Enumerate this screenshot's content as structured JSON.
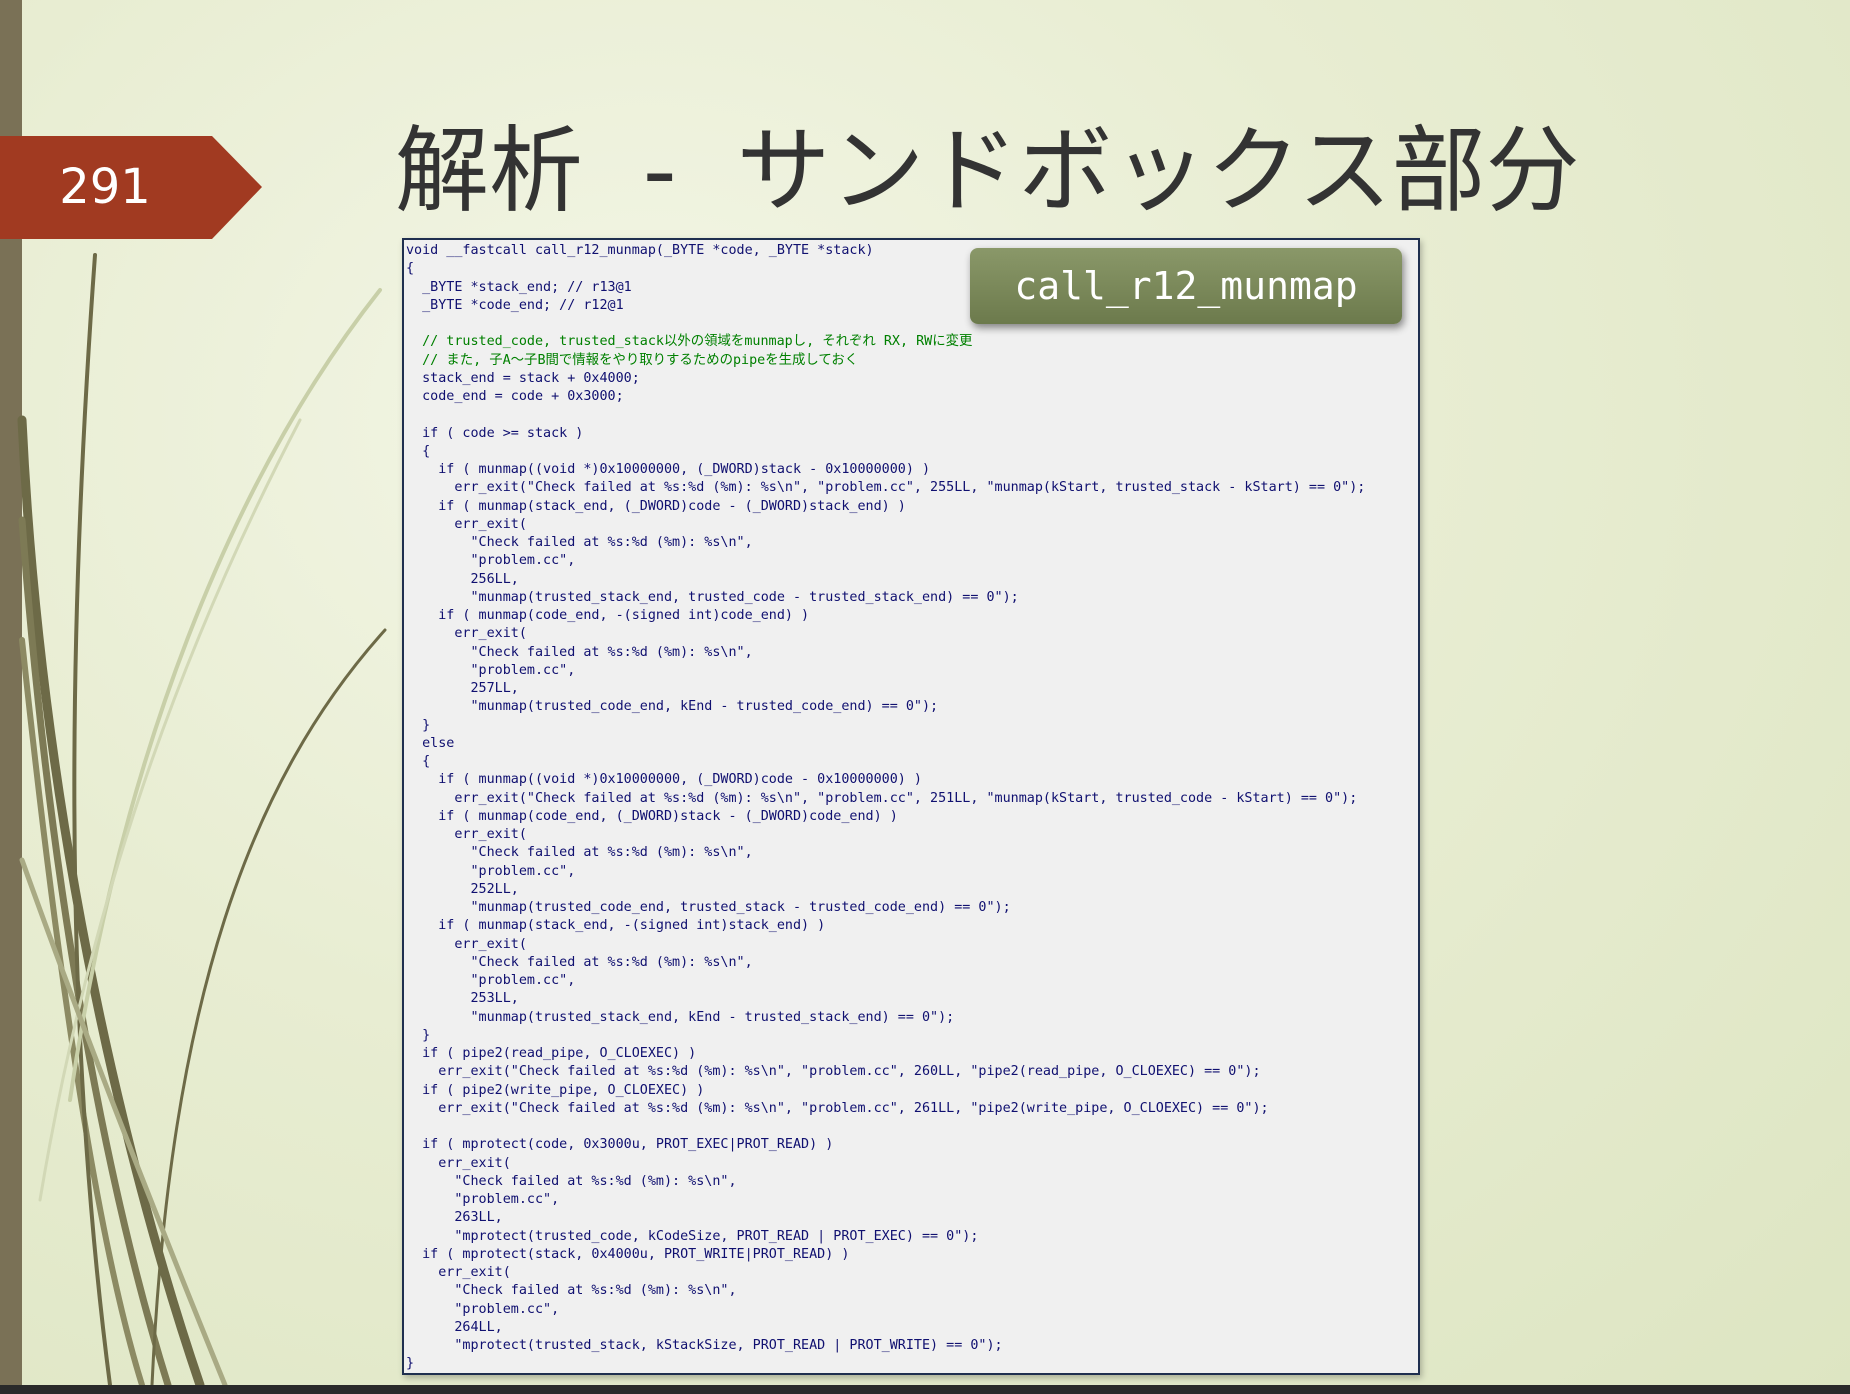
{
  "slide": {
    "number": "291",
    "title": "解析  -  サンドボックス部分",
    "colors": {
      "background": "#e8edd2",
      "number_tag": "#a13a21",
      "badge": "#6c7a4c",
      "panel_border": "#1f2f4f",
      "code_text": "#101070",
      "code_comment": "#008000"
    }
  },
  "callout": {
    "label": "call_r12_munmap"
  },
  "code": {
    "lines": [
      "void __fastcall call_r12_munmap(_BYTE *code, _BYTE *stack)",
      "{",
      "  _BYTE *stack_end; // r13@1",
      "  _BYTE *code_end; // r12@1",
      "",
      "  // trusted_code, trusted_stack以外の領域をmunmapし, それぞれ RX, RWに変更",
      "  // また, 子A〜子B間で情報をやり取りするためのpipeを生成しておく",
      "  stack_end = stack + 0x4000;",
      "  code_end = code + 0x3000;",
      "",
      "  if ( code >= stack )",
      "  {",
      "    if ( munmap((void *)0x10000000, (_DWORD)stack - 0x10000000) )",
      "      err_exit(\"Check failed at %s:%d (%m): %s\\n\", \"problem.cc\", 255LL, \"munmap(kStart, trusted_stack - kStart) == 0\");",
      "    if ( munmap(stack_end, (_DWORD)code - (_DWORD)stack_end) )",
      "      err_exit(",
      "        \"Check failed at %s:%d (%m): %s\\n\",",
      "        \"problem.cc\",",
      "        256LL,",
      "        \"munmap(trusted_stack_end, trusted_code - trusted_stack_end) == 0\");",
      "    if ( munmap(code_end, -(signed int)code_end) )",
      "      err_exit(",
      "        \"Check failed at %s:%d (%m): %s\\n\",",
      "        \"problem.cc\",",
      "        257LL,",
      "        \"munmap(trusted_code_end, kEnd - trusted_code_end) == 0\");",
      "  }",
      "  else",
      "  {",
      "    if ( munmap((void *)0x10000000, (_DWORD)code - 0x10000000) )",
      "      err_exit(\"Check failed at %s:%d (%m): %s\\n\", \"problem.cc\", 251LL, \"munmap(kStart, trusted_code - kStart) == 0\");",
      "    if ( munmap(code_end, (_DWORD)stack - (_DWORD)code_end) )",
      "      err_exit(",
      "        \"Check failed at %s:%d (%m): %s\\n\",",
      "        \"problem.cc\",",
      "        252LL,",
      "        \"munmap(trusted_code_end, trusted_stack - trusted_code_end) == 0\");",
      "    if ( munmap(stack_end, -(signed int)stack_end) )",
      "      err_exit(",
      "        \"Check failed at %s:%d (%m): %s\\n\",",
      "        \"problem.cc\",",
      "        253LL,",
      "        \"munmap(trusted_stack_end, kEnd - trusted_stack_end) == 0\");",
      "  }",
      "  if ( pipe2(read_pipe, O_CLOEXEC) )",
      "    err_exit(\"Check failed at %s:%d (%m): %s\\n\", \"problem.cc\", 260LL, \"pipe2(read_pipe, O_CLOEXEC) == 0\");",
      "  if ( pipe2(write_pipe, O_CLOEXEC) )",
      "    err_exit(\"Check failed at %s:%d (%m): %s\\n\", \"problem.cc\", 261LL, \"pipe2(write_pipe, O_CLOEXEC) == 0\");",
      "",
      "  if ( mprotect(code, 0x3000u, PROT_EXEC|PROT_READ) )",
      "    err_exit(",
      "      \"Check failed at %s:%d (%m): %s\\n\",",
      "      \"problem.cc\",",
      "      263LL,",
      "      \"mprotect(trusted_code, kCodeSize, PROT_READ | PROT_EXEC) == 0\");",
      "  if ( mprotect(stack, 0x4000u, PROT_WRITE|PROT_READ) )",
      "    err_exit(",
      "      \"Check failed at %s:%d (%m): %s\\n\",",
      "      \"problem.cc\",",
      "      264LL,",
      "      \"mprotect(trusted_stack, kStackSize, PROT_READ | PROT_WRITE) == 0\");",
      "}"
    ]
  }
}
